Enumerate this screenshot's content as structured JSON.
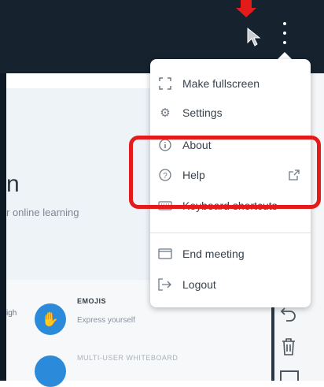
{
  "main": {
    "heading": "n",
    "subtitle": "r online learning",
    "left_snippet": "igh"
  },
  "emojis_card": {
    "title": "EMOJIS",
    "description": "Express yourself"
  },
  "next_card": {
    "title": "MULTI-USER WHITEBOARD"
  },
  "options_menu": {
    "items": [
      {
        "label": "Make fullscreen",
        "icon": "fullscreen-icon"
      },
      {
        "label": "Settings",
        "icon": "gear-icon"
      },
      {
        "label": "About",
        "icon": "info-icon"
      },
      {
        "label": "Help",
        "icon": "help-icon",
        "trailing_icon": "external-link-icon"
      },
      {
        "label": "Keyboard shortcuts",
        "icon": "keyboard-icon"
      },
      {
        "label": "End meeting",
        "icon": "window-icon"
      },
      {
        "label": "Logout",
        "icon": "logout-icon"
      }
    ]
  },
  "colors": {
    "topbar": "#16232f",
    "annotation_red": "#e31b1b",
    "accent_blue": "#2b8ad9",
    "menu_background": "#ffffff"
  }
}
